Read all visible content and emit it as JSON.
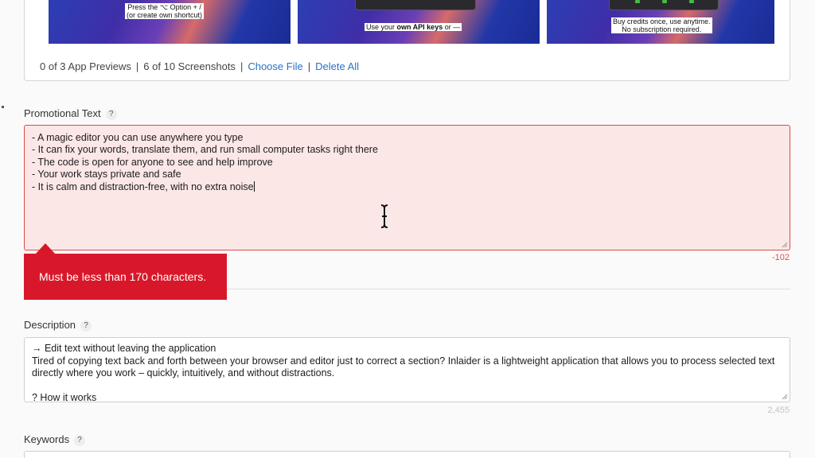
{
  "gallery": {
    "shot1_caption_line1": "Press the ⌥ Option + /",
    "shot1_caption_line2": "(or create own shortcut)",
    "shot2_caption_pre": "Use your ",
    "shot2_caption_bold": "own API keys",
    "shot2_caption_post": " or —",
    "shot3_caption_line1": "Buy credits once, use anytime.",
    "shot3_caption_line2": "No subscription required.",
    "app_previews": "0 of 3 App Previews",
    "screenshots": "6 of 10 Screenshots",
    "choose_file": "Choose File",
    "delete_all": "Delete All",
    "separator": "|"
  },
  "promotional_text": {
    "label": "Promotional Text",
    "help": "?",
    "lines": [
      "- A magic editor you can use anywhere you type",
      "- It can fix your words, translate them, and run small computer tasks right there",
      "- The code is open for anyone to see and help improve",
      "- Your work stays private and safe",
      "- It is calm and distraction-free, with no extra noise"
    ],
    "counter": "-102",
    "error_message": "Must be less than 170 characters."
  },
  "description": {
    "label": "Description",
    "help": "?",
    "line1": "→ Edit text without leaving the application",
    "line2": "Tired of copying text back and forth between your browser and editor just to correct a section? Inlaider is a lightweight application that allows you to process selected text directly where you work – quickly, intuitively, and without distractions.",
    "line3": "? How it works",
    "counter": "2,455"
  },
  "keywords": {
    "label": "Keywords",
    "help": "?"
  },
  "colors": {
    "error": "#d8182a",
    "error_bg": "#fbe7e6",
    "link": "#2a72c4"
  }
}
